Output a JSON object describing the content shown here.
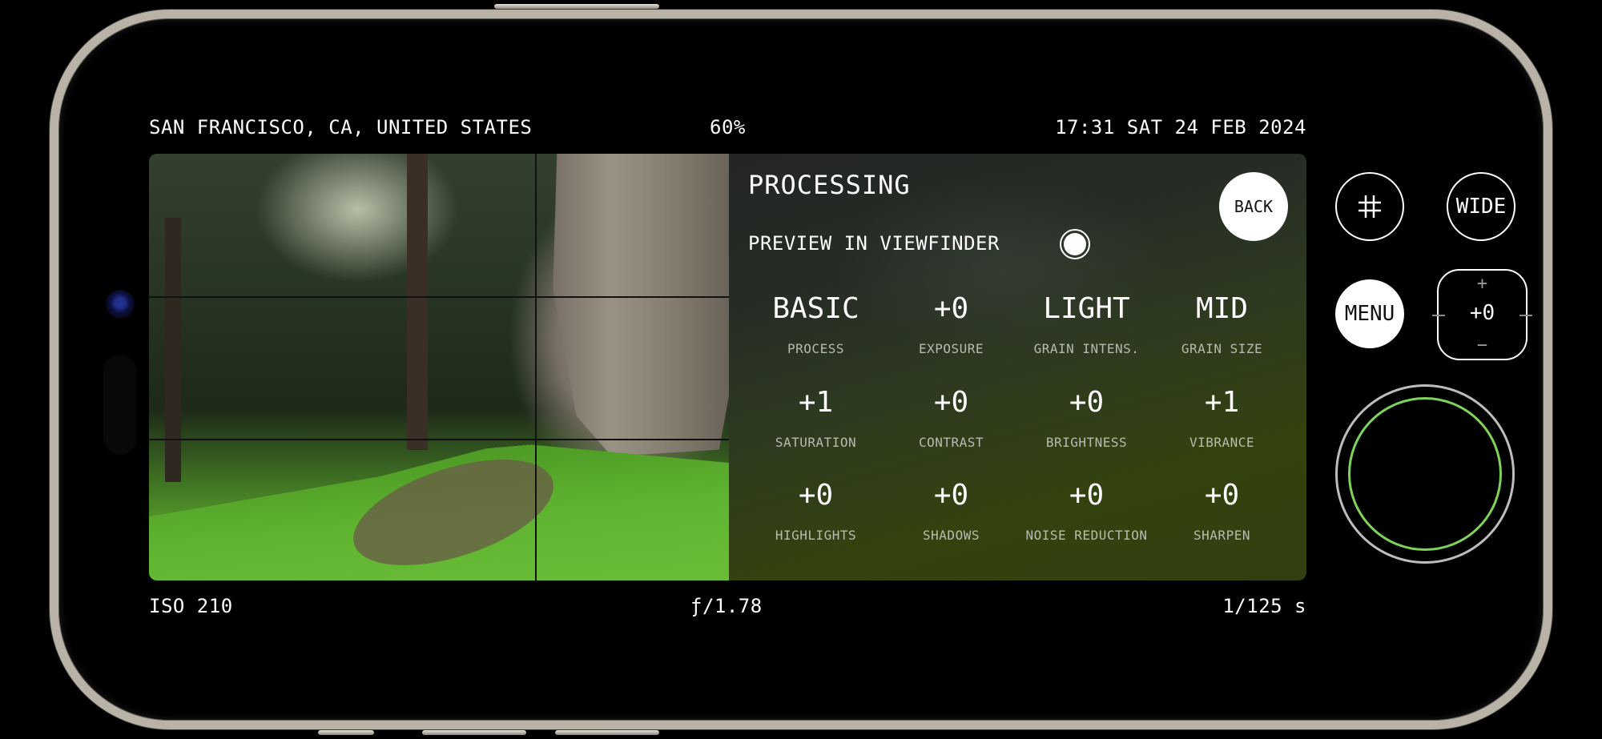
{
  "status_bar": {
    "location": "SAN FRANCISCO, CA, UNITED STATES",
    "battery": "60%",
    "datetime": "17:31 SAT 24 FEB 2024"
  },
  "exposure_info": {
    "iso": "ISO 210",
    "aperture": "ƒ/1.78",
    "shutter_speed": "1/125 s"
  },
  "processing_panel": {
    "title": "PROCESSING",
    "preview_label": "PREVIEW IN VIEWFINDER",
    "preview_enabled": true,
    "back_label": "BACK",
    "settings": [
      {
        "value": "BASIC",
        "label": "PROCESS"
      },
      {
        "value": "+0",
        "label": "EXPOSURE"
      },
      {
        "value": "LIGHT",
        "label": "GRAIN INTENS."
      },
      {
        "value": "MID",
        "label": "GRAIN SIZE"
      },
      {
        "value": "+1",
        "label": "SATURATION"
      },
      {
        "value": "+0",
        "label": "CONTRAST"
      },
      {
        "value": "+0",
        "label": "BRIGHTNESS"
      },
      {
        "value": "+1",
        "label": "VIBRANCE"
      },
      {
        "value": "+0",
        "label": "HIGHLIGHTS"
      },
      {
        "value": "+0",
        "label": "SHADOWS"
      },
      {
        "value": "+0",
        "label": "NOISE REDUCTION"
      },
      {
        "value": "+0",
        "label": "SHARPEN"
      }
    ]
  },
  "controls": {
    "grid_icon": "#",
    "lens_label": "WIDE",
    "menu_label": "MENU",
    "exposure_comp": {
      "plus": "+",
      "value": "+0",
      "minus": "−"
    },
    "shutter_accent": "#7fd35a"
  },
  "viewfinder": {
    "description": "Forest scene with large cypress trunk and green grassy slope",
    "grid_overlay": "rule-of-thirds"
  }
}
